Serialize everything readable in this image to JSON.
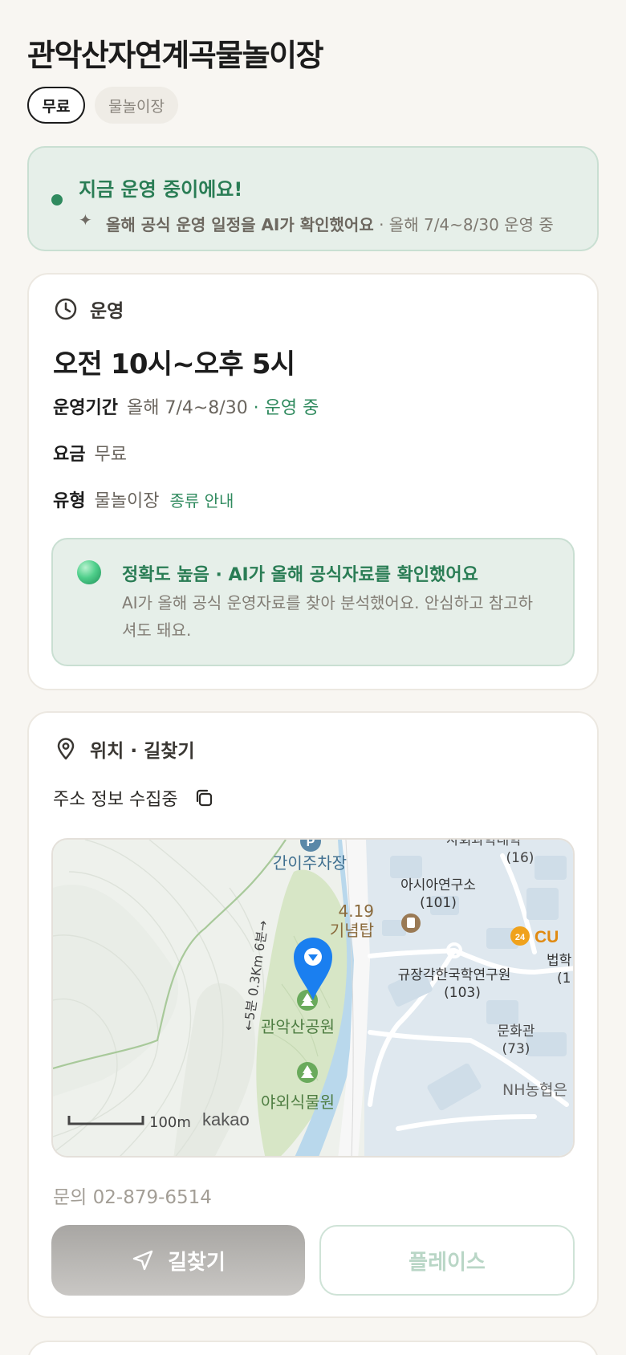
{
  "place": {
    "title": "관악산자연계곡물놀이장",
    "chips": {
      "fee": "무료",
      "type": "물놀이장"
    }
  },
  "status": {
    "title": "지금 운영 중이에요!",
    "sub_bold": "올해 공식 운영 일정을 AI가 확인했어요",
    "sub_rest": " · 올해 7/4~8/30 운영 중"
  },
  "operation": {
    "section_label": "운영",
    "hours": "오전 10시~오후 5시",
    "period_label": "운영기간",
    "period_value": "올해 7/4~8/30",
    "period_status": " · 운영 중",
    "fee_label": "요금",
    "fee_value": "무료",
    "type_label": "유형",
    "type_value": "물놀이장",
    "type_link": "종류 안내",
    "ai_title": "정확도 높음 · AI가 올해 공식자료를 확인했어요",
    "ai_desc": "AI가 올해 공식 운영자료를 찾아 분석했어요. 안심하고 참고하셔도 돼요."
  },
  "location": {
    "section_label": "위치 · 길찾기",
    "address": "주소 정보 수집중",
    "map": {
      "labels": {
        "parking": "간이주차장",
        "asia": "아시아연구소",
        "asia_num": "(101)",
        "top_num": "(16)",
        "top_name": "사회과학대학",
        "memorial_num": "4.19",
        "memorial": "기념탑",
        "cu": "CU",
        "law": "법학",
        "law_num": "(1",
        "kyujang": "규장각한국학연구원",
        "kyujang_num": "(103)",
        "park": "관악산공원",
        "munhwa": "문화관",
        "munhwa_num": "(73)",
        "nh": "NH농협은",
        "garden": "야외식물원",
        "trail": "←5분 0.3Km 6분→",
        "scale": "100m",
        "brand": "kakao",
        "parking_icon": "P",
        "cu_icon": "24"
      }
    },
    "phone": "문의 02-879-6514",
    "route_button": "길찾기",
    "place_button": "플레이스"
  },
  "colors": {
    "accent_green": "#2f8a5e",
    "marker_blue": "#1a7ff0"
  }
}
